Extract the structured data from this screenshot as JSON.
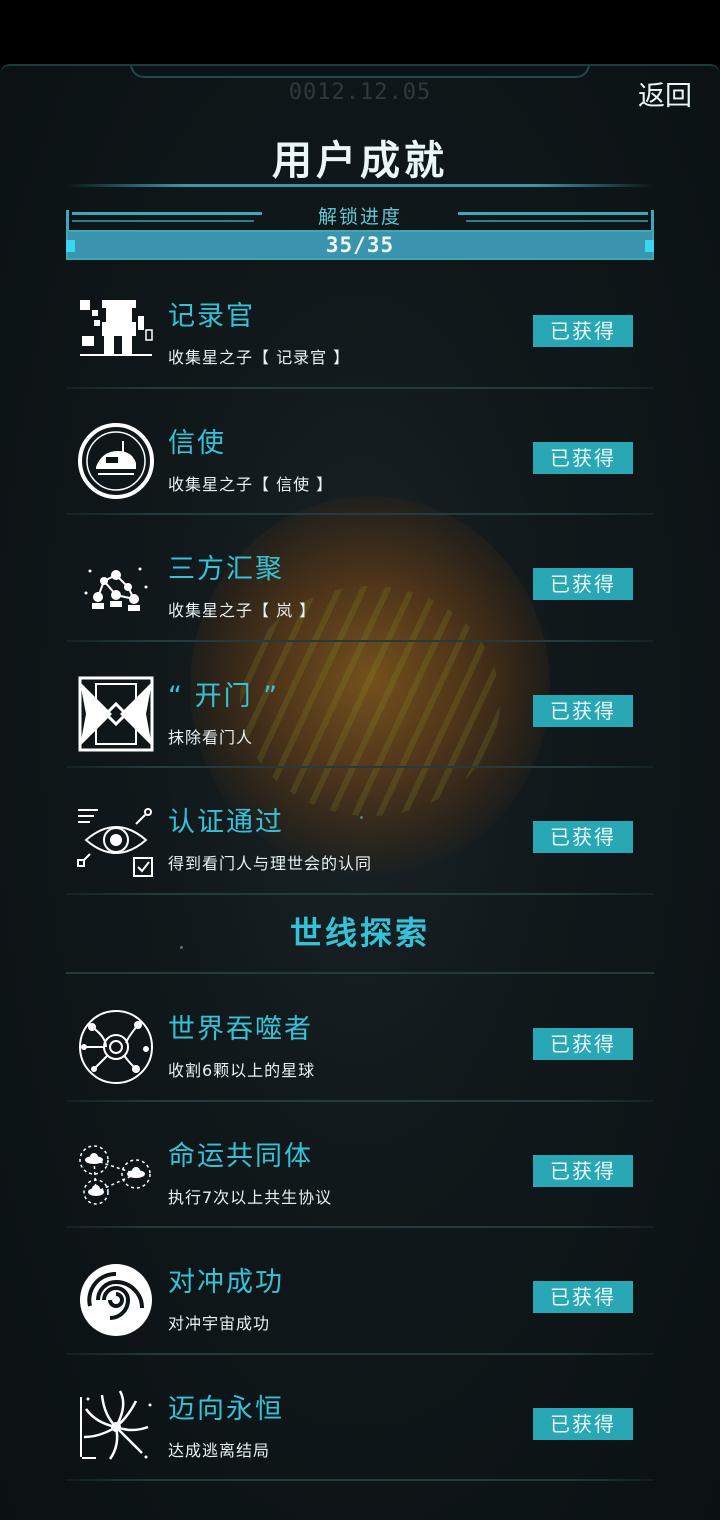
{
  "header": {
    "date": "0012.12.05",
    "back_label": "返回",
    "title": "用户成就"
  },
  "progress": {
    "label": "解锁进度",
    "value": "35/35",
    "unlocked": 35,
    "total": 35,
    "fraction": 1.0
  },
  "colors": {
    "accent": "#35c2d6",
    "badge": "#2aa7b5",
    "progress_fill": "#3a94ad",
    "background": "#10181b"
  },
  "achievements": [
    {
      "title": "记录官",
      "desc": "收集星之子【 记录官 】",
      "status": "已获得",
      "icon": "recorder-robot-icon"
    },
    {
      "title": "信使",
      "desc": "收集星之子【 信使 】",
      "status": "已获得",
      "icon": "messenger-ship-icon"
    },
    {
      "title": "三方汇聚",
      "desc": "收集星之子【 岚 】",
      "status": "已获得",
      "icon": "three-party-network-icon"
    },
    {
      "title": "“ 开门 ”",
      "desc": "抹除看门人",
      "status": "已获得",
      "icon": "open-door-icon"
    },
    {
      "title": "认证通过",
      "desc": "得到看门人与理世会的认同",
      "status": "已获得",
      "icon": "eye-verified-icon"
    }
  ],
  "section": {
    "title": "世线探索"
  },
  "exploration": [
    {
      "title": "世界吞噬者",
      "desc": "收割6颗以上的星球",
      "status": "已获得",
      "icon": "world-devourer-icon"
    },
    {
      "title": "命运共同体",
      "desc": "执行7次以上共生协议",
      "status": "已获得",
      "icon": "shared-destiny-icon"
    },
    {
      "title": "对冲成功",
      "desc": "对冲宇宙成功",
      "status": "已获得",
      "icon": "vortex-icon"
    },
    {
      "title": "迈向永恒",
      "desc": "达成逃离结局",
      "status": "已获得",
      "icon": "black-hole-icon"
    }
  ]
}
